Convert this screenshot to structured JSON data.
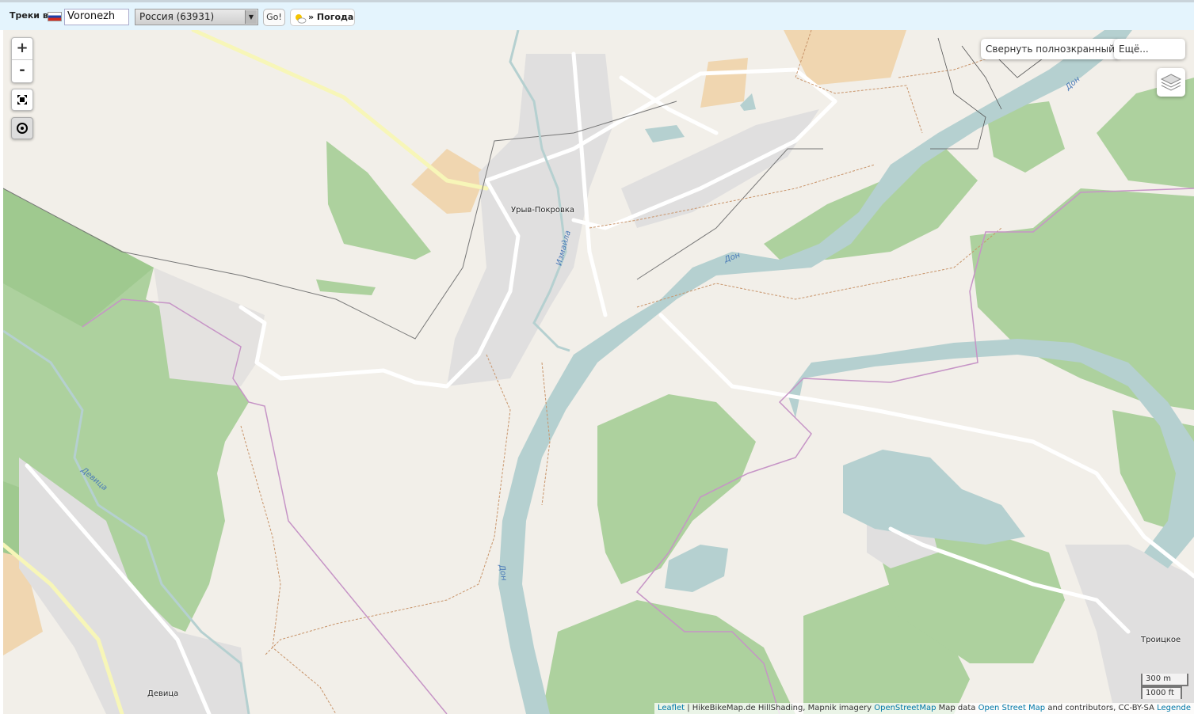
{
  "toolbar": {
    "label": "Треки в",
    "city_value": "Voronezh",
    "country_select": "Россия (63931)",
    "go_label": "Go!",
    "weather_label": "» Погода"
  },
  "map_controls": {
    "zoom_in": "+",
    "zoom_out": "-",
    "fullscreen_button": "Свернуть полнозкранный",
    "more_button": "Ещё..."
  },
  "map_labels": {
    "village_1": "Урыв-Покровка",
    "village_2": "Девица",
    "village_3": "Троицкое",
    "river_don": "Дон",
    "river_devitsa": "Девица",
    "river_izmaylа": "Измайла"
  },
  "scale": {
    "metric": "300 m",
    "imperial": "1000 ft"
  },
  "attribution": {
    "leaflet": "Leaflet",
    "rest": " | HikeBikeMap.de HillShading, Mapnik imagery ",
    "osm_link": "OpenStreetMap",
    "mid": " Map data ",
    "osm_link2": "Open Street Map",
    "tail": " and contributors, CC-BY-SA ",
    "legend": "Legende"
  },
  "colors": {
    "land": "#f2efe9",
    "forest": "#add19e",
    "water": "#b5d0d0",
    "residential": "#e0dfdf",
    "farm": "#f0d6b0"
  }
}
